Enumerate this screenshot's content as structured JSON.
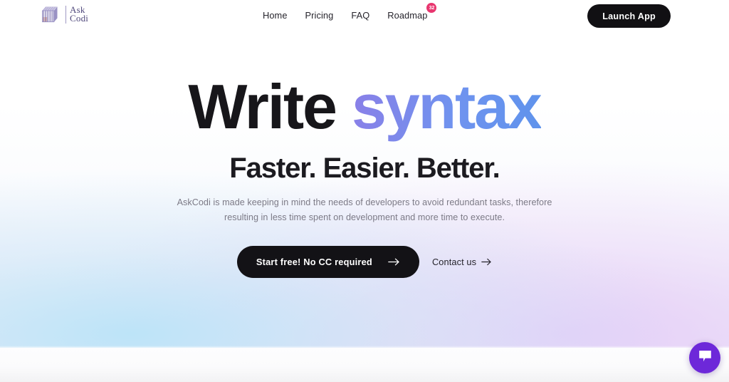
{
  "brand": {
    "logo_icon": "striped-cube-logo-icon",
    "name_line1": "Ask",
    "name_line2": "Codi",
    "accent_purple": "#514a7d"
  },
  "header": {
    "nav": [
      {
        "label": "Home",
        "badge": null
      },
      {
        "label": "Pricing",
        "badge": null
      },
      {
        "label": "FAQ",
        "badge": null
      },
      {
        "label": "Roadmap",
        "badge": "32"
      }
    ],
    "badge_color": "#e8366f",
    "launch_label": "Launch App",
    "launch_bg": "#111013"
  },
  "hero": {
    "headline_dark": "Write",
    "headline_gradient": "syntax",
    "gradient_from": "#8a7fe8",
    "gradient_to": "#5f93ec",
    "subheadline": "Faster. Easier. Better.",
    "paragraph_line1": "AskCodi is made keeping in mind the needs of developers to avoid redundant tasks, therefore",
    "paragraph_line2": "resulting in less time spent on development and more time to execute.",
    "cta_primary_label": "Start free! No CC required",
    "cta_primary_icon": "arrow-right-icon",
    "cta_secondary_label": "Contact us",
    "cta_secondary_icon": "arrow-right-icon"
  },
  "widgets": {
    "chat_icon": "chat-bubble-icon",
    "chat_bg": "#6d28d9"
  }
}
